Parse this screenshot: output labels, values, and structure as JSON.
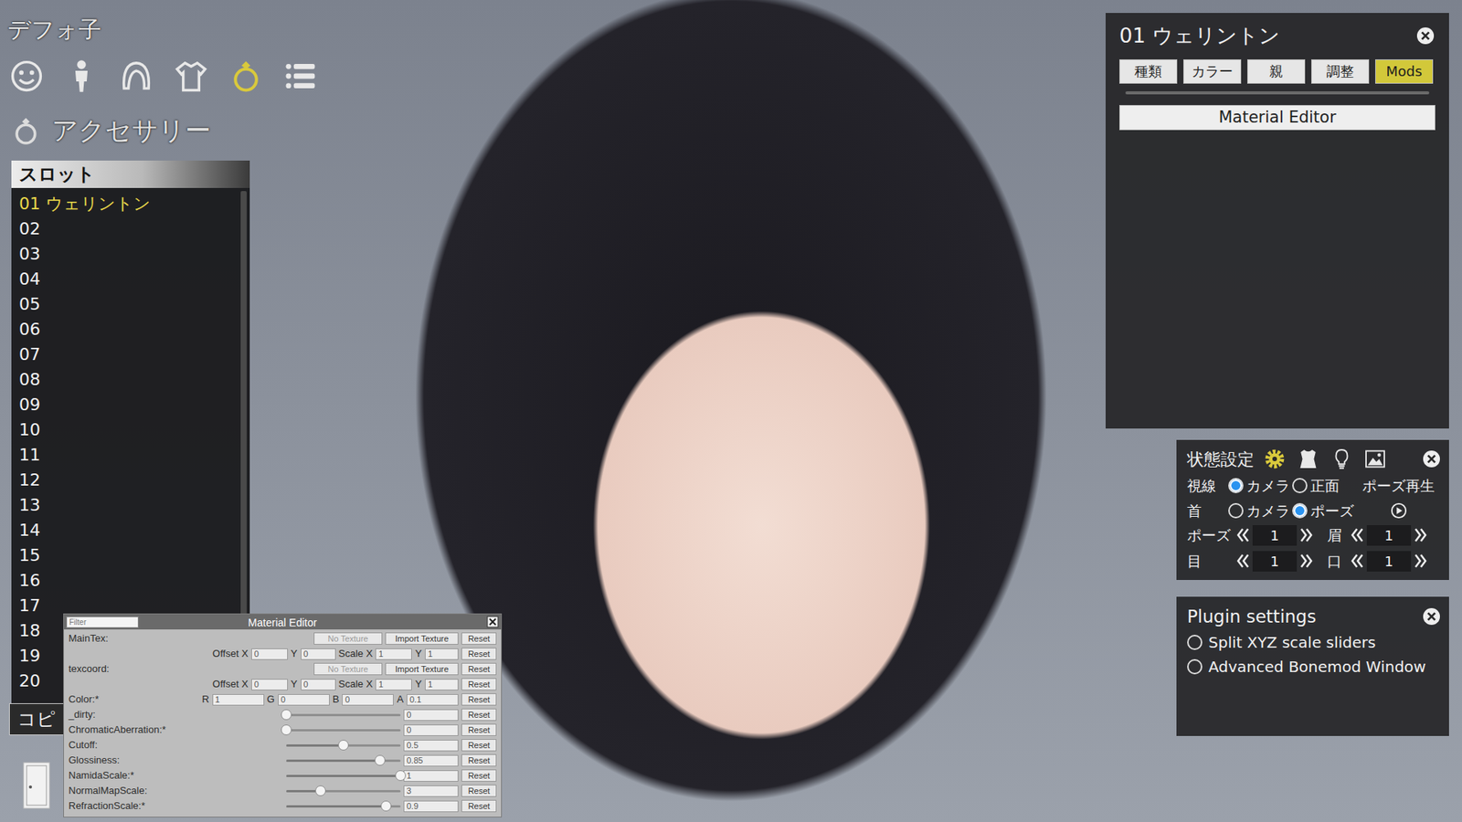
{
  "character": {
    "name": "デフォ子"
  },
  "categories": [
    {
      "kind": "face",
      "selected": false
    },
    {
      "kind": "body",
      "selected": false
    },
    {
      "kind": "hair",
      "selected": false
    },
    {
      "kind": "clothes",
      "selected": false
    },
    {
      "kind": "accessory",
      "selected": true
    },
    {
      "kind": "system",
      "selected": false
    }
  ],
  "section": {
    "title": "アクセサリー"
  },
  "slots": {
    "header": "スロット",
    "items": [
      {
        "label": "01 ウェリントン",
        "selected": true
      },
      {
        "label": "02",
        "selected": false
      },
      {
        "label": "03",
        "selected": false
      },
      {
        "label": "04",
        "selected": false
      },
      {
        "label": "05",
        "selected": false
      },
      {
        "label": "06",
        "selected": false
      },
      {
        "label": "07",
        "selected": false
      },
      {
        "label": "08",
        "selected": false
      },
      {
        "label": "09",
        "selected": false
      },
      {
        "label": "10",
        "selected": false
      },
      {
        "label": "11",
        "selected": false
      },
      {
        "label": "12",
        "selected": false
      },
      {
        "label": "13",
        "selected": false
      },
      {
        "label": "14",
        "selected": false
      },
      {
        "label": "15",
        "selected": false
      },
      {
        "label": "16",
        "selected": false
      },
      {
        "label": "17",
        "selected": false
      },
      {
        "label": "18",
        "selected": false
      },
      {
        "label": "19",
        "selected": false
      },
      {
        "label": "20",
        "selected": false
      }
    ],
    "copy_button": "コピ"
  },
  "material_editor": {
    "title": "Material Editor",
    "filter_placeholder": "Filter",
    "rows": [
      {
        "kind": "texture",
        "label": "MainTex:",
        "texture": "No Texture",
        "import": "Import Texture",
        "reset": "Reset"
      },
      {
        "kind": "offset",
        "offset_label": "Offset X",
        "offset_x": "0",
        "offset_y_label": "Y",
        "offset_y": "0",
        "scale_label": "Scale X",
        "scale_x": "1",
        "scale_y_label": "Y",
        "scale_y": "1",
        "reset": "Reset"
      },
      {
        "kind": "texture",
        "label": "texcoord:",
        "texture": "No Texture",
        "import": "Import Texture",
        "reset": "Reset"
      },
      {
        "kind": "offset",
        "offset_label": "Offset X",
        "offset_x": "0",
        "offset_y_label": "Y",
        "offset_y": "0",
        "scale_label": "Scale X",
        "scale_x": "1",
        "scale_y_label": "Y",
        "scale_y": "1",
        "reset": "Reset"
      },
      {
        "kind": "color",
        "label": "Color:*",
        "channels": [
          {
            "label": "R",
            "value": "1"
          },
          {
            "label": "G",
            "value": "0"
          },
          {
            "label": "B",
            "value": "0"
          },
          {
            "label": "A",
            "value": "0.1"
          }
        ],
        "reset": "Reset"
      },
      {
        "kind": "slider",
        "label": "_dirty:",
        "level": 0,
        "value": "0",
        "reset": "Reset"
      },
      {
        "kind": "slider",
        "label": "ChromaticAberration:*",
        "level": 0,
        "value": "0",
        "reset": "Reset"
      },
      {
        "kind": "slider",
        "label": "Cutoff:",
        "level": 0.5,
        "value": "0.5",
        "reset": "Reset"
      },
      {
        "kind": "slider",
        "label": "Glossiness:",
        "level": 0.82,
        "value": "0.85",
        "reset": "Reset"
      },
      {
        "kind": "slider",
        "label": "NamidaScale:*",
        "level": 1,
        "value": "1",
        "reset": "Reset"
      },
      {
        "kind": "slider",
        "label": "NormalMapScale:",
        "level": 0.3,
        "value": "3",
        "reset": "Reset"
      },
      {
        "kind": "slider",
        "label": "RefractionScale:*",
        "level": 0.87,
        "value": "0.9",
        "reset": "Reset"
      }
    ]
  },
  "accessory_panel": {
    "title": "01 ウェリントン",
    "tabs": [
      {
        "label": "種類",
        "selected": false
      },
      {
        "label": "カラー",
        "selected": false
      },
      {
        "label": "親",
        "selected": false
      },
      {
        "label": "調整",
        "selected": false
      },
      {
        "label": "Mods",
        "selected": true
      }
    ],
    "button": "Material Editor"
  },
  "state_panel": {
    "title": "状態設定",
    "tools": [
      {
        "kind": "gear",
        "selected": true
      },
      {
        "kind": "clothes",
        "selected": false
      },
      {
        "kind": "light",
        "selected": false
      },
      {
        "kind": "image",
        "selected": false
      }
    ],
    "radio_rows": [
      {
        "label": "視線",
        "options": [
          {
            "label": "カメラ",
            "selected": true
          },
          {
            "label": "正面",
            "selected": false
          }
        ],
        "extra": "ポーズ再生"
      },
      {
        "label": "首",
        "options": [
          {
            "label": "カメラ",
            "selected": false
          },
          {
            "label": "ポーズ",
            "selected": true
          }
        ]
      }
    ],
    "steppers": [
      [
        {
          "label": "ポーズ",
          "value": "1"
        },
        {
          "label": "眉",
          "value": "1"
        }
      ],
      [
        {
          "label": "目",
          "value": "1"
        },
        {
          "label": "口",
          "value": "1"
        }
      ]
    ]
  },
  "plugin_settings": {
    "title": "Plugin settings",
    "options": [
      {
        "label": "Split XYZ scale sliders",
        "checked": false
      },
      {
        "label": "Advanced Bonemod Window",
        "checked": false
      }
    ]
  }
}
